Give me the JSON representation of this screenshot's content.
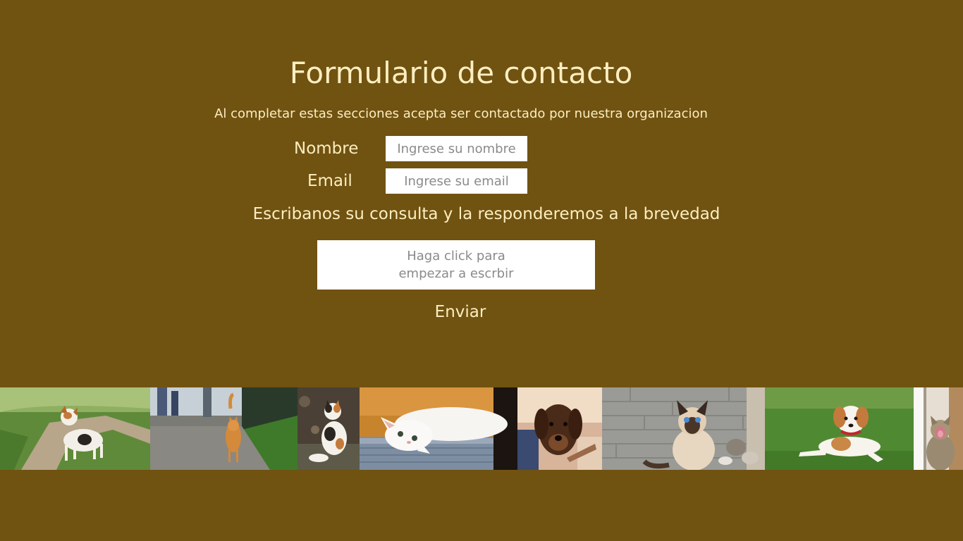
{
  "form": {
    "title": "Formulario de contacto",
    "subtitle": "Al completar estas secciones acepta ser contactado por nuestra organizacion",
    "name_label": "Nombre",
    "name_placeholder": "Ingrese su nombre",
    "email_label": "Email",
    "email_placeholder": "Ingrese su email",
    "message_prompt": "Escribanos su consulta y la responderemos a la brevedad",
    "message_placeholder": "Haga click para empezar a escrbir",
    "submit_label": "Enviar"
  },
  "colors": {
    "background": "#705211",
    "text": "#fbeec0",
    "field_background": "#ffffff",
    "placeholder": "#8a8a8a"
  },
  "photo_strip": [
    {
      "subject": "dog-on-trail"
    },
    {
      "subject": "cat-on-path"
    },
    {
      "subject": "calico-cat"
    },
    {
      "subject": "white-kitten-on-blanket"
    },
    {
      "subject": "dachshund-puppy"
    },
    {
      "subject": "siamese-cat"
    },
    {
      "subject": "puppy-on-grass"
    },
    {
      "subject": "yawning-cat"
    }
  ]
}
